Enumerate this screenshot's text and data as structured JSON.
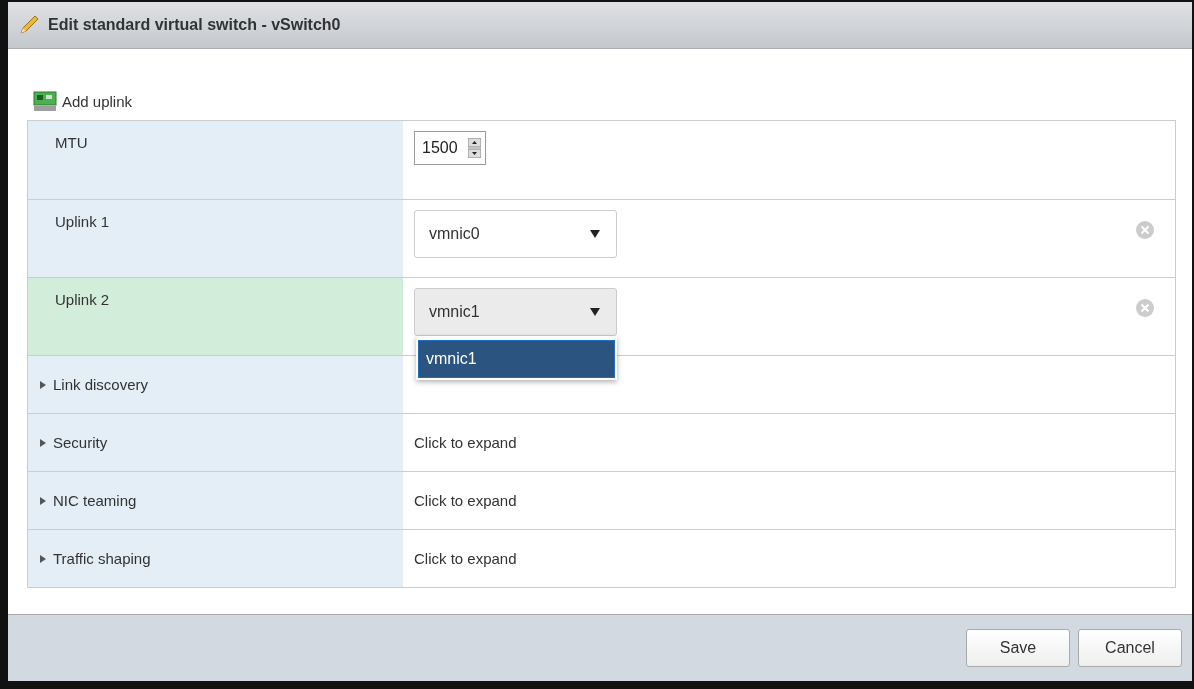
{
  "window": {
    "title": "Edit standard virtual switch - vSwitch0"
  },
  "toolbar": {
    "add_uplink": "Add uplink"
  },
  "rows": [
    {
      "kind": "number",
      "label": "MTU",
      "highlighted": false,
      "value": "1500"
    },
    {
      "kind": "select",
      "label": "Uplink 1",
      "highlighted": false,
      "value": "vmnic0",
      "open": false
    },
    {
      "kind": "select",
      "label": "Uplink 2",
      "highlighted": true,
      "value": "vmnic1",
      "open": true,
      "options": [
        {
          "label": "vmnic1",
          "selected": true
        }
      ]
    },
    {
      "kind": "section",
      "label": "Link discovery",
      "highlighted": false,
      "expanded": false
    },
    {
      "kind": "section",
      "label": "Security",
      "highlighted": false,
      "expanded": false,
      "value": "Click to expand"
    },
    {
      "kind": "section",
      "label": "NIC teaming",
      "highlighted": false,
      "expanded": false,
      "value": "Click to expand"
    },
    {
      "kind": "section",
      "label": "Traffic shaping",
      "highlighted": false,
      "expanded": false,
      "value": "Click to expand"
    }
  ],
  "buttons": [
    "Save",
    "Cancel"
  ]
}
